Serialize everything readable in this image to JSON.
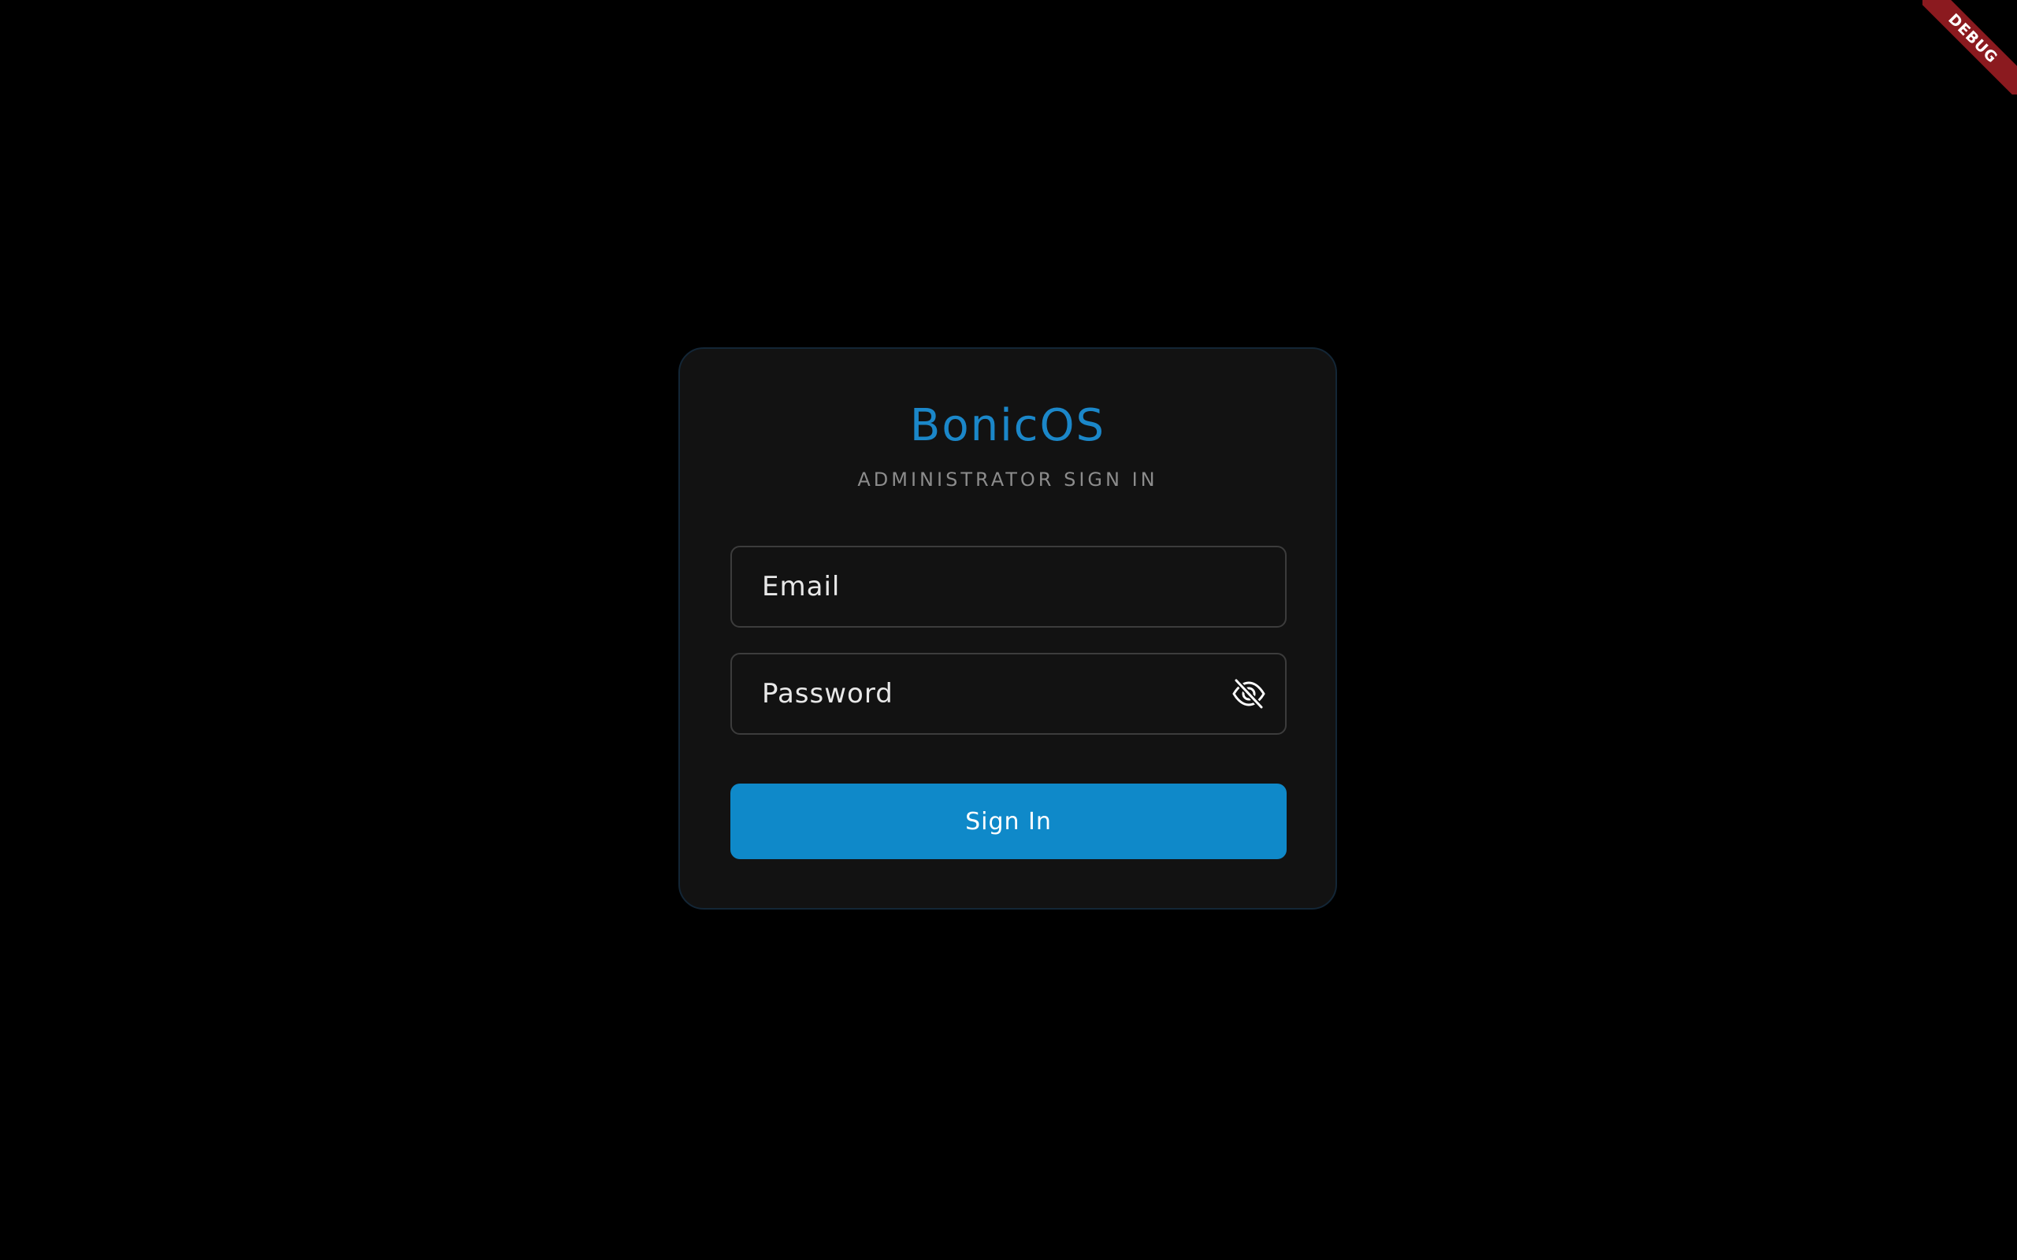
{
  "app": {
    "brand": "BonicOS",
    "subtitle": "ADMINISTRATOR SIGN IN"
  },
  "form": {
    "email": {
      "value": "",
      "placeholder": "Email"
    },
    "password": {
      "value": "",
      "placeholder": "Password",
      "visibility_icon": "eye-off-icon"
    },
    "submit_label": "Sign In"
  },
  "debug_banner": "DEBUG",
  "colors": {
    "background": "#000000",
    "card": "#121212",
    "card_border": "#132636",
    "accent": "#1b87c9",
    "button": "#0f89c9",
    "field_border": "#3c3c3c",
    "subtitle": "#8c8c8c",
    "debug_ribbon": "#8b1a1f"
  }
}
